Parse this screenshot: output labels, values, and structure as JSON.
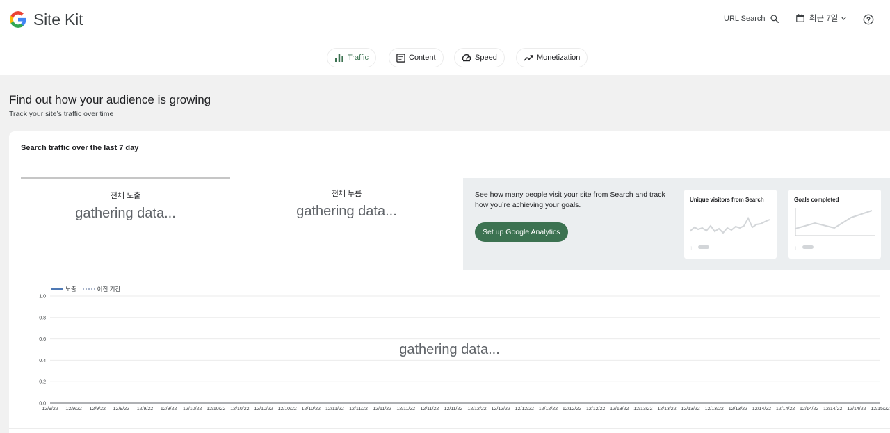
{
  "header": {
    "brand": "Site Kit",
    "url_search_label": "URL Search",
    "date_range_label": "최근 7일"
  },
  "tabs": [
    {
      "label": "Traffic",
      "icon": "bar-chart-icon",
      "active": true
    },
    {
      "label": "Content",
      "icon": "article-icon",
      "active": false
    },
    {
      "label": "Speed",
      "icon": "speedometer-icon",
      "active": false
    },
    {
      "label": "Monetization",
      "icon": "trending-up-icon",
      "active": false
    }
  ],
  "intro": {
    "title": "Find out how your audience is growing",
    "subtitle": "Track your site’s traffic over time"
  },
  "card": {
    "title": "Search traffic over the last 7 day",
    "metrics": [
      {
        "label": "전체 노출",
        "value": "gathering data..."
      },
      {
        "label": "전체 누름",
        "value": "gathering data..."
      }
    ],
    "cta": {
      "text": "See how many people visit your site from Search and track how you’re achieving your goals.",
      "button_label": "Set up Google Analytics",
      "previews": [
        {
          "title": "Unique visitors from Search"
        },
        {
          "title": "Goals completed"
        }
      ]
    },
    "chart_overlay": "gathering data..."
  },
  "colors": {
    "accent": "#3c7251",
    "series_primary": "#4e79b5",
    "series_previous": "#a7b3c9",
    "page_background": "#f1f1f1",
    "cta_background": "#ebeef0"
  },
  "chart_data": {
    "type": "line",
    "legend": [
      "노출",
      "이전 기간"
    ],
    "legend_position": "top-left",
    "y_ticks": [
      "1.0",
      "0.8",
      "0.6",
      "0.4",
      "0.2",
      "0.0"
    ],
    "ylim": [
      0,
      1
    ],
    "x_ticks": [
      "12/9/22",
      "12/9/22",
      "12/9/22",
      "12/9/22",
      "12/9/22",
      "12/9/22",
      "12/10/22",
      "12/10/22",
      "12/10/22",
      "12/10/22",
      "12/10/22",
      "12/10/22",
      "12/11/22",
      "12/11/22",
      "12/11/22",
      "12/11/22",
      "12/11/22",
      "12/11/22",
      "12/12/22",
      "12/12/22",
      "12/12/22",
      "12/12/22",
      "12/12/22",
      "12/12/22",
      "12/13/22",
      "12/13/22",
      "12/13/22",
      "12/13/22",
      "12/13/22",
      "12/13/22",
      "12/14/22",
      "12/14/22",
      "12/14/22",
      "12/14/22",
      "12/14/22",
      "12/15/22"
    ],
    "series": [
      {
        "name": "노출",
        "values": []
      },
      {
        "name": "이전 기간",
        "values": []
      }
    ],
    "grid": true,
    "status": "gathering data..."
  }
}
